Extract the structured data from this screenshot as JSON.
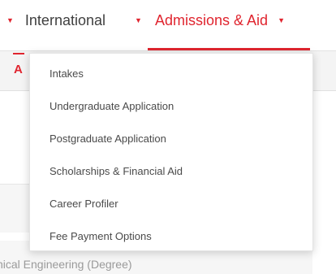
{
  "colors": {
    "accent": "#e0252f",
    "text": "#3f3f3f",
    "submenu_bg": "#f4f4f4"
  },
  "nav": {
    "items": [
      {
        "caret": "▼",
        "label": "International"
      },
      {
        "caret": "▼",
        "label": "Admissions & Aid",
        "active": true
      }
    ],
    "trailing_caret": "▼"
  },
  "subnav": {
    "label": "A"
  },
  "dropdown": {
    "items": [
      {
        "label": "Intakes"
      },
      {
        "label": "Undergraduate Application"
      },
      {
        "label": "Postgraduate Application"
      },
      {
        "label": "Scholarships & Financial Aid"
      },
      {
        "label": "Career Profiler"
      },
      {
        "label": "Fee Payment Options"
      }
    ]
  },
  "content": {
    "partial_text": "nical Engineering (Degree)"
  }
}
